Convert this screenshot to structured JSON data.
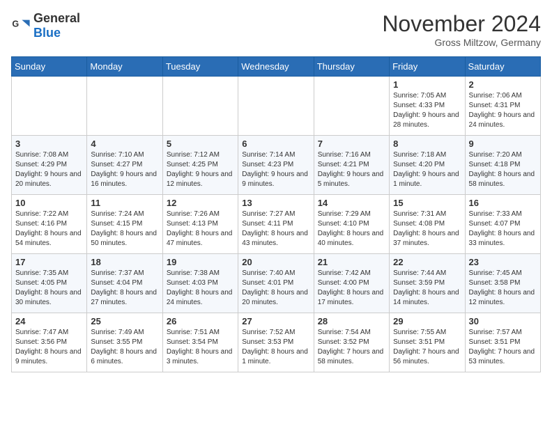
{
  "header": {
    "logo": {
      "general": "General",
      "blue": "Blue"
    },
    "month": "November 2024",
    "location": "Gross Miltzow, Germany"
  },
  "weekdays": [
    "Sunday",
    "Monday",
    "Tuesday",
    "Wednesday",
    "Thursday",
    "Friday",
    "Saturday"
  ],
  "weeks": [
    [
      {
        "day": "",
        "info": ""
      },
      {
        "day": "",
        "info": ""
      },
      {
        "day": "",
        "info": ""
      },
      {
        "day": "",
        "info": ""
      },
      {
        "day": "",
        "info": ""
      },
      {
        "day": "1",
        "info": "Sunrise: 7:05 AM\nSunset: 4:33 PM\nDaylight: 9 hours and 28 minutes."
      },
      {
        "day": "2",
        "info": "Sunrise: 7:06 AM\nSunset: 4:31 PM\nDaylight: 9 hours and 24 minutes."
      }
    ],
    [
      {
        "day": "3",
        "info": "Sunrise: 7:08 AM\nSunset: 4:29 PM\nDaylight: 9 hours and 20 minutes."
      },
      {
        "day": "4",
        "info": "Sunrise: 7:10 AM\nSunset: 4:27 PM\nDaylight: 9 hours and 16 minutes."
      },
      {
        "day": "5",
        "info": "Sunrise: 7:12 AM\nSunset: 4:25 PM\nDaylight: 9 hours and 12 minutes."
      },
      {
        "day": "6",
        "info": "Sunrise: 7:14 AM\nSunset: 4:23 PM\nDaylight: 9 hours and 9 minutes."
      },
      {
        "day": "7",
        "info": "Sunrise: 7:16 AM\nSunset: 4:21 PM\nDaylight: 9 hours and 5 minutes."
      },
      {
        "day": "8",
        "info": "Sunrise: 7:18 AM\nSunset: 4:20 PM\nDaylight: 9 hours and 1 minute."
      },
      {
        "day": "9",
        "info": "Sunrise: 7:20 AM\nSunset: 4:18 PM\nDaylight: 8 hours and 58 minutes."
      }
    ],
    [
      {
        "day": "10",
        "info": "Sunrise: 7:22 AM\nSunset: 4:16 PM\nDaylight: 8 hours and 54 minutes."
      },
      {
        "day": "11",
        "info": "Sunrise: 7:24 AM\nSunset: 4:15 PM\nDaylight: 8 hours and 50 minutes."
      },
      {
        "day": "12",
        "info": "Sunrise: 7:26 AM\nSunset: 4:13 PM\nDaylight: 8 hours and 47 minutes."
      },
      {
        "day": "13",
        "info": "Sunrise: 7:27 AM\nSunset: 4:11 PM\nDaylight: 8 hours and 43 minutes."
      },
      {
        "day": "14",
        "info": "Sunrise: 7:29 AM\nSunset: 4:10 PM\nDaylight: 8 hours and 40 minutes."
      },
      {
        "day": "15",
        "info": "Sunrise: 7:31 AM\nSunset: 4:08 PM\nDaylight: 8 hours and 37 minutes."
      },
      {
        "day": "16",
        "info": "Sunrise: 7:33 AM\nSunset: 4:07 PM\nDaylight: 8 hours and 33 minutes."
      }
    ],
    [
      {
        "day": "17",
        "info": "Sunrise: 7:35 AM\nSunset: 4:05 PM\nDaylight: 8 hours and 30 minutes."
      },
      {
        "day": "18",
        "info": "Sunrise: 7:37 AM\nSunset: 4:04 PM\nDaylight: 8 hours and 27 minutes."
      },
      {
        "day": "19",
        "info": "Sunrise: 7:38 AM\nSunset: 4:03 PM\nDaylight: 8 hours and 24 minutes."
      },
      {
        "day": "20",
        "info": "Sunrise: 7:40 AM\nSunset: 4:01 PM\nDaylight: 8 hours and 20 minutes."
      },
      {
        "day": "21",
        "info": "Sunrise: 7:42 AM\nSunset: 4:00 PM\nDaylight: 8 hours and 17 minutes."
      },
      {
        "day": "22",
        "info": "Sunrise: 7:44 AM\nSunset: 3:59 PM\nDaylight: 8 hours and 14 minutes."
      },
      {
        "day": "23",
        "info": "Sunrise: 7:45 AM\nSunset: 3:58 PM\nDaylight: 8 hours and 12 minutes."
      }
    ],
    [
      {
        "day": "24",
        "info": "Sunrise: 7:47 AM\nSunset: 3:56 PM\nDaylight: 8 hours and 9 minutes."
      },
      {
        "day": "25",
        "info": "Sunrise: 7:49 AM\nSunset: 3:55 PM\nDaylight: 8 hours and 6 minutes."
      },
      {
        "day": "26",
        "info": "Sunrise: 7:51 AM\nSunset: 3:54 PM\nDaylight: 8 hours and 3 minutes."
      },
      {
        "day": "27",
        "info": "Sunrise: 7:52 AM\nSunset: 3:53 PM\nDaylight: 8 hours and 1 minute."
      },
      {
        "day": "28",
        "info": "Sunrise: 7:54 AM\nSunset: 3:52 PM\nDaylight: 7 hours and 58 minutes."
      },
      {
        "day": "29",
        "info": "Sunrise: 7:55 AM\nSunset: 3:51 PM\nDaylight: 7 hours and 56 minutes."
      },
      {
        "day": "30",
        "info": "Sunrise: 7:57 AM\nSunset: 3:51 PM\nDaylight: 7 hours and 53 minutes."
      }
    ]
  ]
}
